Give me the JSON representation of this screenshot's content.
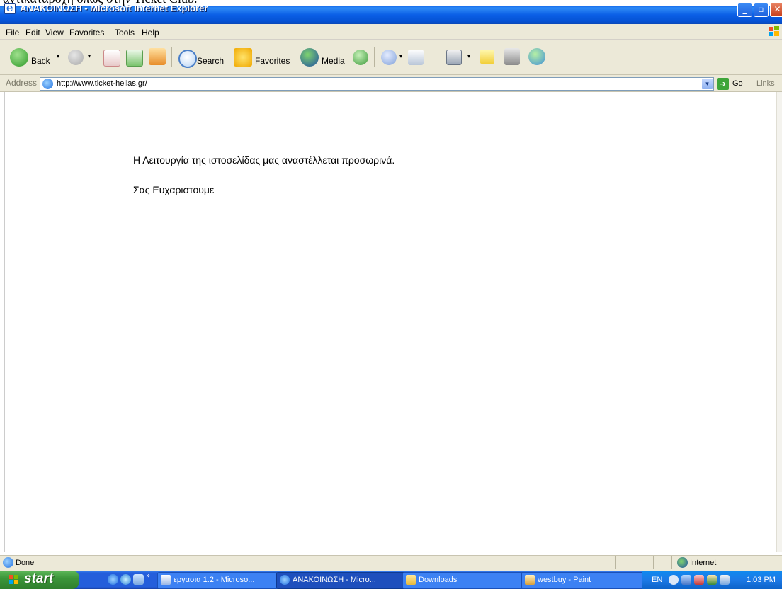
{
  "window": {
    "caption_fragment": "αντικαταροχή όπως στην Ticket Club.",
    "title": "ΑΝΑΚΟΙΝΩΣΗ - Microsoft Internet Explorer",
    "minimize": "_",
    "maximize": "▫",
    "close": "✕"
  },
  "menu": {
    "items": [
      "File",
      "Edit",
      "View",
      "Favorites",
      "Tools",
      "Help"
    ]
  },
  "toolbar": {
    "back_label": "Back",
    "search_label": "Search",
    "favorites_label": "Favorites",
    "media_label": "Media",
    "dropdown_arrow": "▾"
  },
  "address": {
    "label": "Address",
    "url": "http://www.ticket-hellas.gr/",
    "go_label": "Go",
    "links_label": "Links",
    "dropdown_glyph": "▾",
    "go_glyph": "➔"
  },
  "content": {
    "line1": "Η Λειτουργία της ιστοσελίδας μας αναστέλλεται προσωρινά.",
    "line2": "Σας Ευχαριστουμε"
  },
  "status": {
    "text": "Done",
    "zone": "Internet"
  },
  "taskbar": {
    "start_label": "start",
    "more_glyph": "»",
    "tasks": [
      "εργασια 1.2 - Microso...",
      "ΑΝΑΚΟΙΝΩΣΗ - Micro...",
      "Downloads",
      "westbuy - Paint"
    ],
    "language": "EN",
    "clock": "1:03 PM"
  },
  "colors": {
    "title_bar": "#0b5fe6",
    "chrome": "#ece9d8",
    "start_button": "#3c963a",
    "taskbar": "#245edb"
  }
}
